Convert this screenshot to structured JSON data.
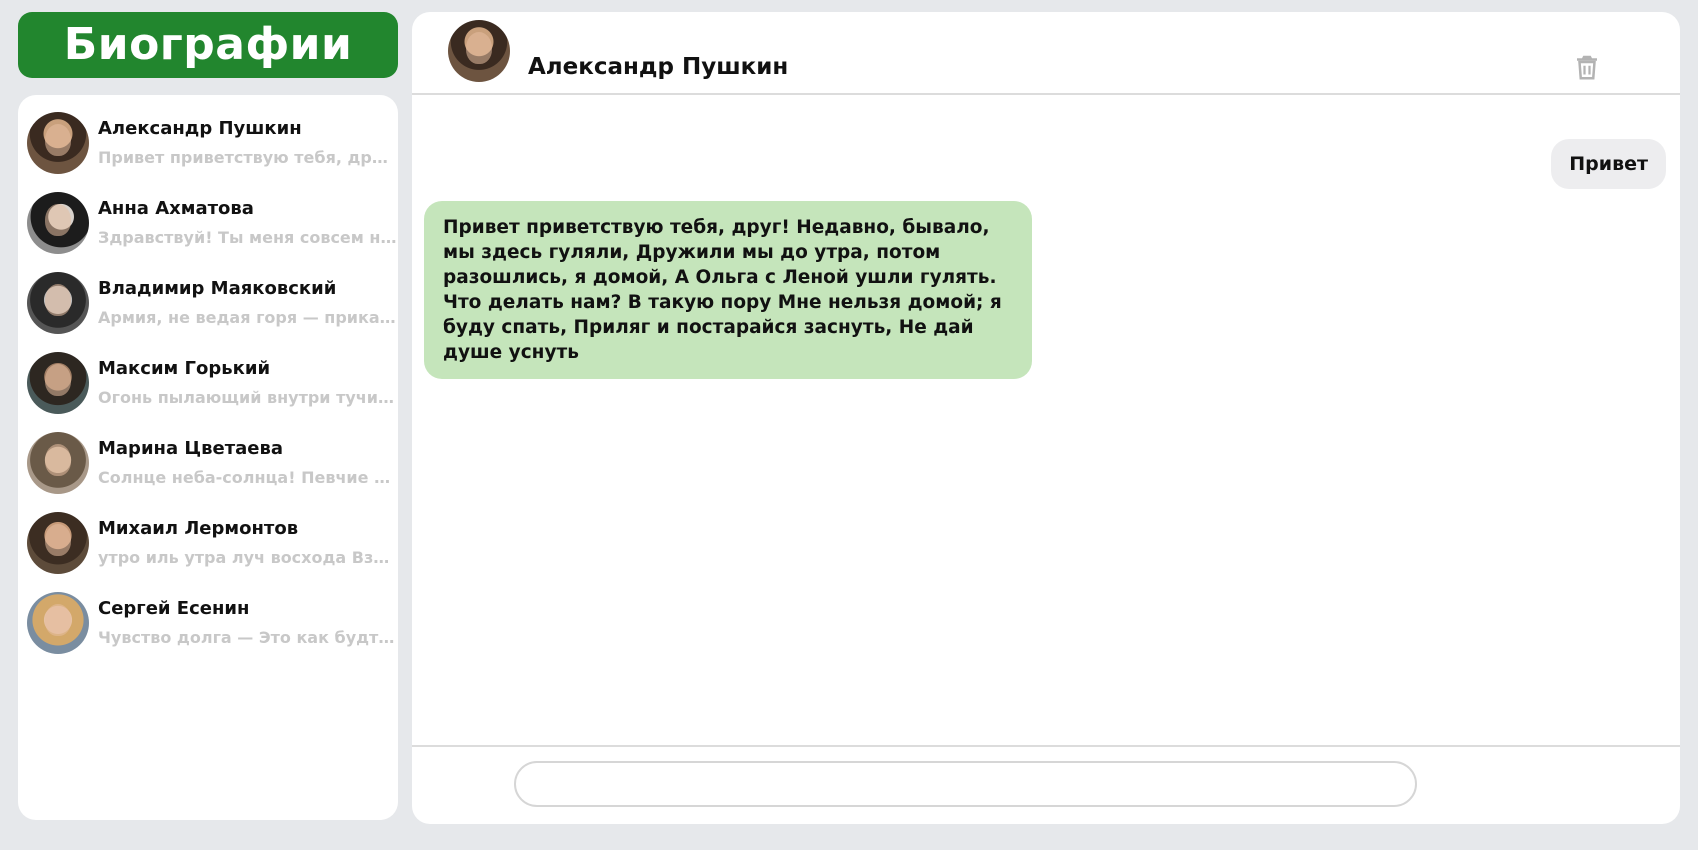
{
  "app": {
    "title": "Биографии",
    "accent": "#22862e"
  },
  "contacts": [
    {
      "name": "Александр Пушкин",
      "preview": "Привет приветствую тебя, друг! Недавно, бывало, мы здесь гуляли",
      "avatar": "pushkin-portrait"
    },
    {
      "name": "Анна Ахматова",
      "preview": "Здравствуй! Ты меня совсем не знаешь",
      "avatar": "akhmatova-portrait"
    },
    {
      "name": "Владимир Маяковский",
      "preview": "Армия, не ведая горя — приказ, приказ",
      "avatar": "mayakovsky-portrait"
    },
    {
      "name": "Максим Горький",
      "preview": "Огонь пылающий внутри тучи, Огонь",
      "avatar": "gorky-portrait"
    },
    {
      "name": "Марина Цветаева",
      "preview": "Солнце неба-солнца! Певчие — лучи",
      "avatar": "tsvetaeva-portrait"
    },
    {
      "name": "Михаил Лермонтов",
      "preview": "утро иль утра луч восхода Взорвался",
      "avatar": "lermontov-portrait"
    },
    {
      "name": "Сергей Есенин",
      "preview": "Чувство долга — Это как будто мы",
      "avatar": "esenin-portrait"
    }
  ],
  "chat": {
    "contact_name": "Александр Пушкин",
    "delete_icon": "trash-icon",
    "messages": [
      {
        "direction": "outgoing",
        "text": "Привет"
      },
      {
        "direction": "incoming",
        "text": "Привет приветствую тебя, друг! Недавно, бывало, мы здесь гуляли, Дружили мы до утра, потом разошлись, я домой, А Ольга с Леной ушли гулять. Что делать нам? В такую пору Мне нельзя домой; я буду спать, Приляг и постарайся заснуть, Не дай душе уснуть"
      }
    ],
    "input": {
      "value": "",
      "placeholder": ""
    }
  }
}
